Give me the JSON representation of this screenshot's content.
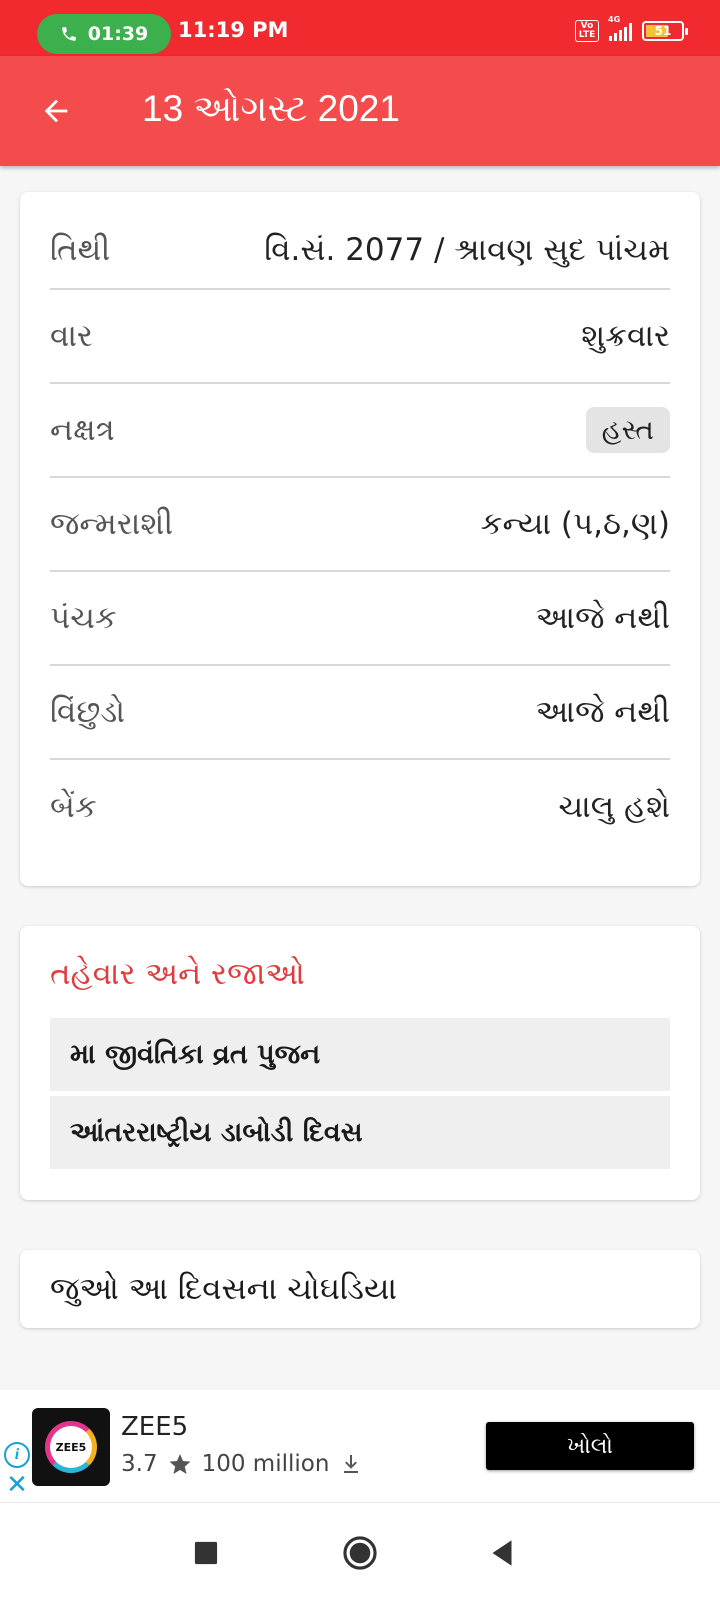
{
  "status_bar": {
    "call_timer": "01:39",
    "time": "11:19 PM",
    "volte_label": "Vo\nLTE",
    "network": "4G",
    "battery": "51"
  },
  "app_bar": {
    "title": "13 ઓગસ્ટ 2021"
  },
  "info": {
    "rows": [
      {
        "label": "તિથી",
        "value": "વિ.સં. 2077 / શ્રાવણ સુદ પાંચમ"
      },
      {
        "label": "વાર",
        "value": "શુક્રવાર"
      },
      {
        "label": "નક્ષત્ર",
        "value": "હસ્ત"
      },
      {
        "label": "જન્મરાશી",
        "value": "કન્યા (પ,ઠ,ણ)"
      },
      {
        "label": "પંચક",
        "value": "આજે નથી"
      },
      {
        "label": "વિંછુડો",
        "value": "આજે નથી"
      },
      {
        "label": "બેંક",
        "value": "ચાલુ હશે"
      }
    ]
  },
  "festivals": {
    "title": "તહેવાર અને રજાઓ",
    "items": [
      "મા જીવંતિકા વ્રત પુજન",
      "આંતરરાષ્ટ્રીય ડાબોડી દિવસ"
    ]
  },
  "choghadiya_link": "જુઓ આ દિવસના ચોઘડિયા",
  "ad": {
    "app_name": "ZEE5",
    "logo_text": "ZEE5",
    "rating": "3.7",
    "downloads": "100 million",
    "cta": "ખોલો"
  },
  "colors": {
    "status_bar": "#f02a2e",
    "app_bar": "#f44c4c",
    "accent_text": "#e23c3c"
  }
}
